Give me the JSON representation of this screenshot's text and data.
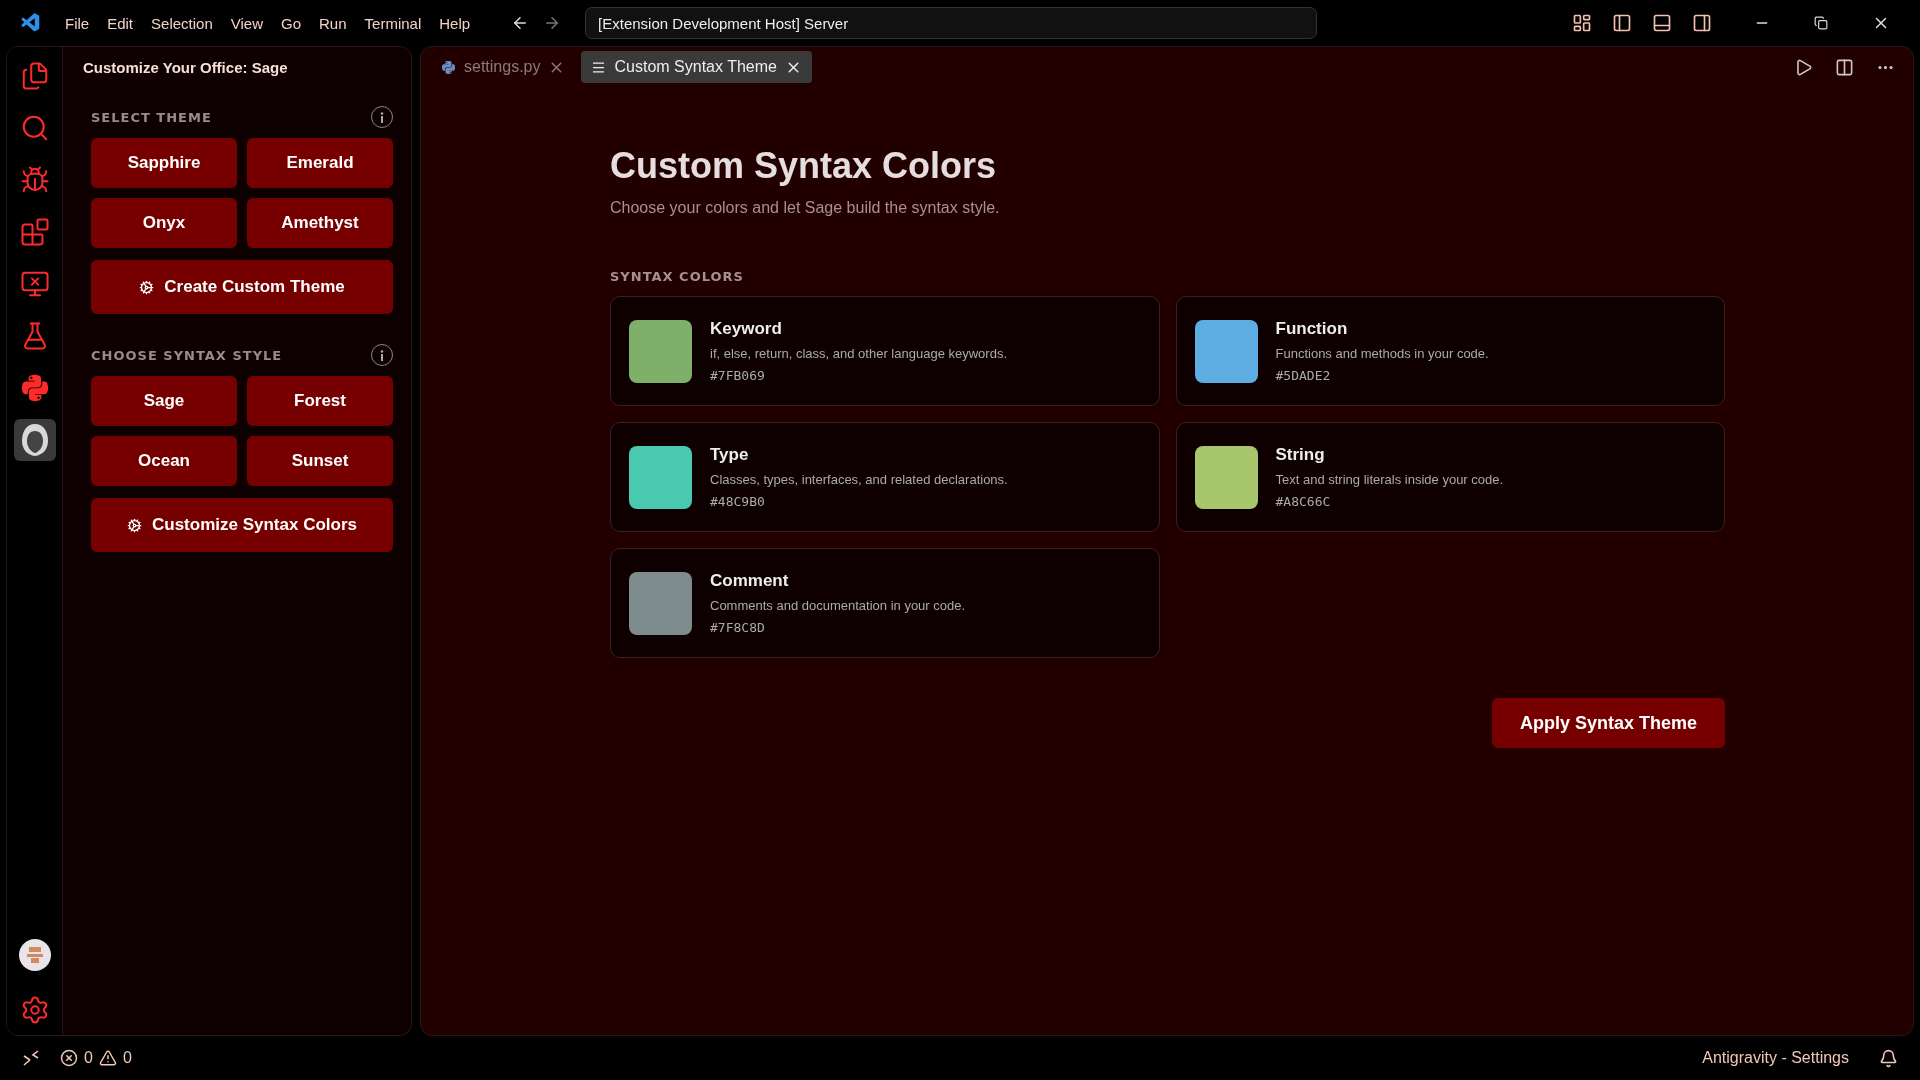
{
  "menu": [
    "File",
    "Edit",
    "Selection",
    "View",
    "Go",
    "Run",
    "Terminal",
    "Help"
  ],
  "command_center": {
    "value": "[Extension Development Host] Server"
  },
  "activity_bar": [
    {
      "kind": "files",
      "selected": false
    },
    {
      "kind": "search",
      "selected": false
    },
    {
      "kind": "debug",
      "selected": false
    },
    {
      "kind": "extensions",
      "selected": false
    },
    {
      "kind": "remote",
      "selected": false
    },
    {
      "kind": "testing",
      "selected": false
    },
    {
      "kind": "python",
      "selected": false
    },
    {
      "kind": "extension",
      "selected": true
    }
  ],
  "sidebar": {
    "title": "Customize Your Office: Sage",
    "sections": [
      {
        "heading": "SELECT THEME",
        "options": [
          "Sapphire",
          "Emerald",
          "Onyx",
          "Amethyst"
        ],
        "action": "Create Custom Theme"
      },
      {
        "heading": "CHOOSE SYNTAX STYLE",
        "options": [
          "Sage",
          "Forest",
          "Ocean",
          "Sunset"
        ],
        "action": "Customize Syntax Colors"
      }
    ]
  },
  "tabs": [
    {
      "label": "settings.py",
      "kind": "python",
      "selected": false
    },
    {
      "label": "Custom Syntax Theme",
      "kind": "preview",
      "selected": true
    }
  ],
  "page": {
    "title": "Custom Syntax Colors",
    "subtitle": "Choose your colors and let Sage build the syntax style.",
    "section": "SYNTAX COLORS",
    "colors": [
      {
        "name": "Keyword",
        "description": "if, else, return, class, and other language keywords.",
        "hex": "#7FB069",
        "color": "#7fb069"
      },
      {
        "name": "Function",
        "description": "Functions and methods in your code.",
        "hex": "#5DADE2",
        "color": "#5dade2"
      },
      {
        "name": "Type",
        "description": "Classes, types, interfaces, and related declarations.",
        "hex": "#48C9B0",
        "color": "#48c9b0"
      },
      {
        "name": "String",
        "description": "Text and string literals inside your code.",
        "hex": "#A8C66C",
        "color": "#a8c66c"
      },
      {
        "name": "Comment",
        "description": "Comments and documentation in your code.",
        "hex": "#7F8C8D",
        "color": "#7f8c8d"
      }
    ],
    "apply": "Apply Syntax Theme"
  },
  "status_bar": {
    "errors": "0",
    "warnings": "0",
    "right": "Antigravity - Settings"
  }
}
